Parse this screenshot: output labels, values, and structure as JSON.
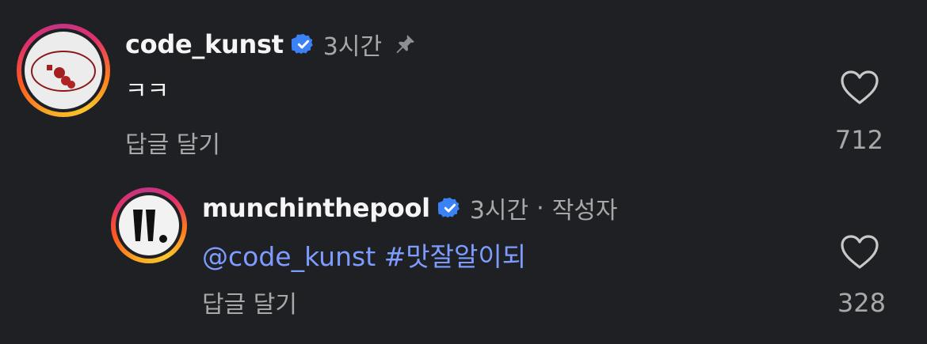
{
  "comments": [
    {
      "username": "code_kunst",
      "verified": true,
      "time": "3시간",
      "pinned": true,
      "text": "ㅋㅋ",
      "reply_label": "답글 달기",
      "likes": "712",
      "avatar": "code-kunst-logo"
    },
    {
      "username": "munchinthepool",
      "verified": true,
      "time": "3시간",
      "separator": "·",
      "author_label": "작성자",
      "text": "@code_kunst #맛잘알이되",
      "reply_label": "답글 달기",
      "likes": "328",
      "avatar": "munchinthepool-logo"
    }
  ],
  "colors": {
    "background": "#1f2024",
    "primary_text": "#f5f5f5",
    "secondary_text": "#a8a8a8",
    "link": "#7e9cff",
    "verified_badge": "#3b82f6"
  }
}
